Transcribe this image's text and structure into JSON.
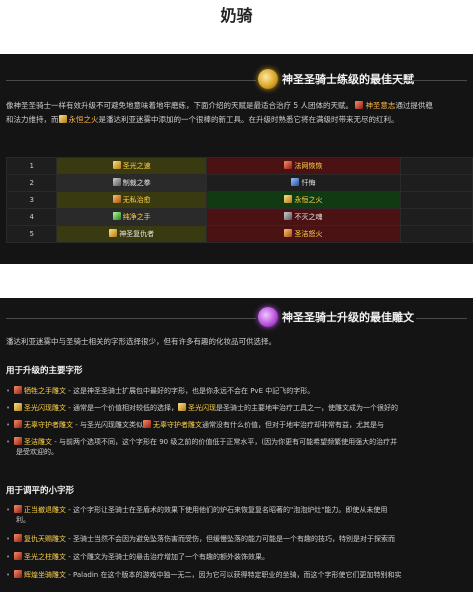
{
  "page": {
    "title": "奶骑"
  },
  "talents_panel": {
    "header": "神圣圣骑士练级的最佳天赋",
    "intro_line1_a": "像神圣圣骑士一样有效升级不可避免地意味着地牢磨练，下面介绍的天赋是最适合治疗 5 人团体的天赋。",
    "intro_line1_b": "神圣意志",
    "intro_line1_c": "通过提供稳",
    "intro_line2_a": "和法力维持，而",
    "intro_line2_b": "永恒之火",
    "intro_line2_c": "是潘达利亚迷雾中添加的一个很棒的新工具。在升级时熟悉它将在满级时带来无尽的红利。",
    "rows": [
      {
        "level": "1",
        "c1": "圣光之速",
        "c2": "法网恢恢",
        "c3": ""
      },
      {
        "level": "2",
        "c1": "制裁之拳",
        "c2": "忏悔",
        "c3": ""
      },
      {
        "level": "3",
        "c1": "无私治愈",
        "c2": "永恒之火",
        "c3": ""
      },
      {
        "level": "4",
        "c1": "纯净之手",
        "c2": "不灭之魂",
        "c3": ""
      },
      {
        "level": "5",
        "c1": "神圣复仇者",
        "c2": "圣洁怒火",
        "c3": ""
      }
    ]
  },
  "glyphs_panel": {
    "header": "神圣圣骑士升级的最佳雕文",
    "intro": "潘达利亚迷雾中与圣骑士相关的字形选择很少，但有许多有趣的化妆品可供选择。",
    "major_title": "用于升级的主要字形",
    "major": [
      {
        "name": "牺牲之手雕文",
        "text": " - 这是神圣圣骑士扩展包中最好的字形，也是你永远不会在 PvE 中記飞的字形。"
      },
      {
        "name": "圣光闪现雕文",
        "text": " - 通常是一个价值相对较低的选择，",
        "extra_name": "圣光闪现",
        "extra": "是圣骑士的主要地牢治疗工具之一，使雕文成为一个很好的"
      },
      {
        "name": "无辜守护者雕文",
        "text": " - 与圣光闪现雕文类似",
        "extra_name": "无辜守护者雕文",
        "extra": "通常没有什么价值，但对于地牢治疗却非常有益，尤其是与"
      },
      {
        "name": "圣洁雕文",
        "text": " - 与前两个选项不同，这个字形在 90 级之前的价值低于正常水平，(因为你更有可能希望频繁使用强大的治疗并",
        "line2": "是受欢迎的。"
      }
    ],
    "minor_title": "用于调平的小字形",
    "minor": [
      {
        "name": "正当撤退雕文",
        "text": " - 这个字形让圣骑士在圣盾术的效果下使用他们的炉石来恢复复名昭著的\"泡泡炉灶\"能力。即使从未使用",
        "line2": "利。"
      },
      {
        "name": "复仇天赐雕文",
        "text": " - 圣骑士当然不会因为避免坠落伤害而受伤，但缓慢坠落的能力可能是一个有趣的技巧，特别是对于探索而"
      },
      {
        "name": "圣光之柱雕文",
        "text": " - 这个雕文为圣骑士的悬击治疗增加了一个有趣的额外装饰效果。"
      },
      {
        "name": "辉煌坐骑雕文",
        "text": " - Paladin 在这个版本的游戏中独一无二，因为它可以获得特定职业的坐骑，而这个字形使它们更加特别和实"
      }
    ]
  }
}
